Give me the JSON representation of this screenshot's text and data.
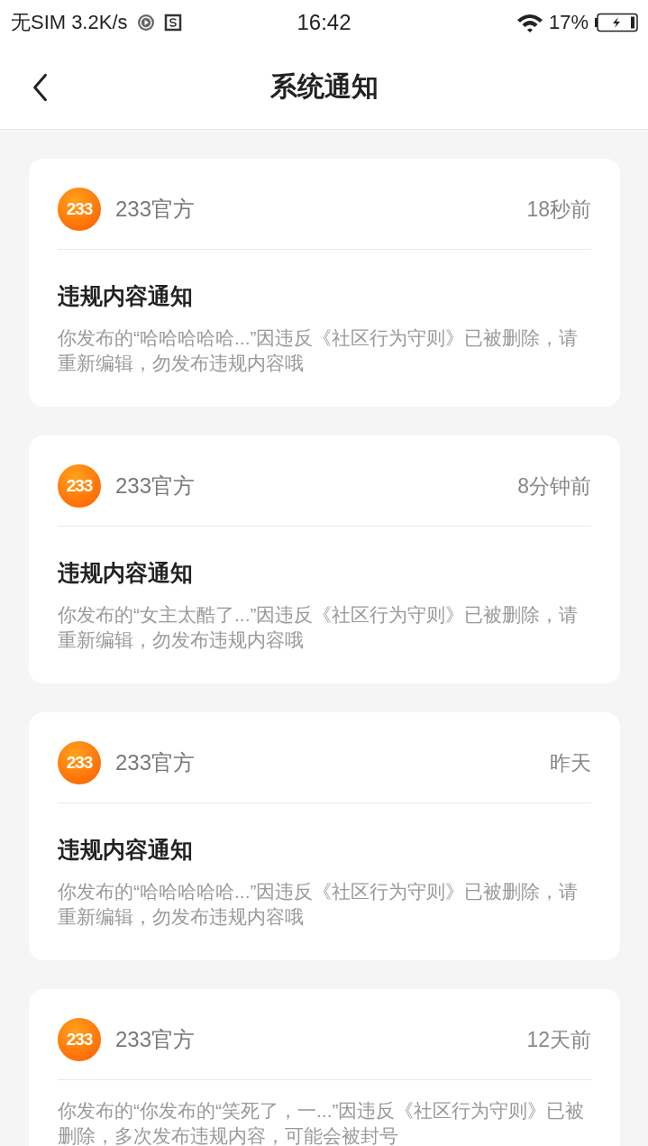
{
  "status_bar": {
    "carrier": "无SIM",
    "speed": "3.2K/s",
    "time": "16:42",
    "battery": "17%"
  },
  "header": {
    "title": "系统通知"
  },
  "notifications": [
    {
      "avatar_text": "233",
      "sender": "233官方",
      "time": "18秒前",
      "title": "违规内容通知",
      "body": "你发布的“哈哈哈哈哈...”因违反《社区行为守则》已被删除，请重新编辑，勿发布违规内容哦"
    },
    {
      "avatar_text": "233",
      "sender": "233官方",
      "time": "8分钟前",
      "title": "违规内容通知",
      "body": "你发布的“女主太酷了...”因违反《社区行为守则》已被删除，请重新编辑，勿发布违规内容哦"
    },
    {
      "avatar_text": "233",
      "sender": "233官方",
      "time": "昨天",
      "title": "违规内容通知",
      "body": "你发布的“哈哈哈哈哈...”因违反《社区行为守则》已被删除，请重新编辑，勿发布违规内容哦"
    },
    {
      "avatar_text": "233",
      "sender": "233官方",
      "time": "12天前",
      "body": "你发布的“你发布的“笑死了，一...”因违反《社区行为守则》已被删除，多次发布违规内容，可能会被封号"
    }
  ]
}
